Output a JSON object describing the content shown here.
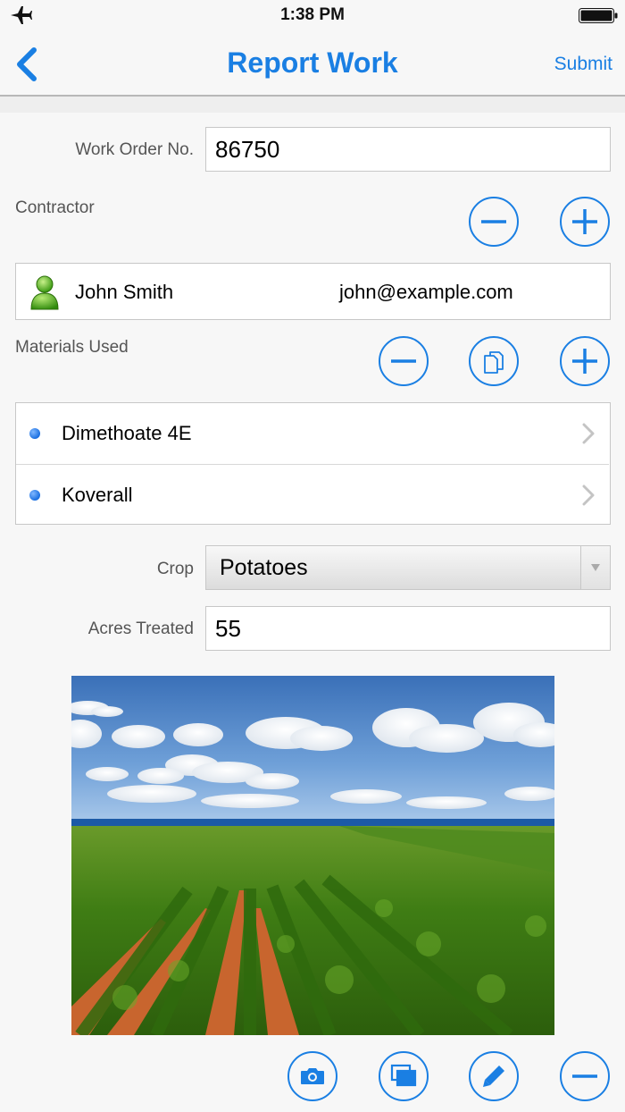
{
  "status_bar": {
    "time": "1:38 PM"
  },
  "nav": {
    "title": "Report Work",
    "submit_label": "Submit"
  },
  "form": {
    "work_order_label": "Work Order No.",
    "work_order_value": "86750",
    "contractor_label": "Contractor",
    "contractor": {
      "name": "John Smith",
      "email": "john@example.com"
    },
    "materials_label": "Materials Used",
    "materials": [
      {
        "label": "Dimethoate 4E"
      },
      {
        "label": "Koverall"
      }
    ],
    "crop_label": "Crop",
    "crop_value": "Potatoes",
    "acres_label": "Acres Treated",
    "acres_value": "55"
  },
  "icons": {
    "status": [
      "airplane-icon",
      "battery-icon"
    ],
    "nav": [
      "back-chevron-icon"
    ],
    "contractor_actions": [
      "minus-icon",
      "plus-icon"
    ],
    "materials_actions": [
      "minus-icon",
      "copy-icon",
      "plus-icon"
    ],
    "photo_actions": [
      "camera-icon",
      "gallery-icon",
      "pencil-icon",
      "minus-icon"
    ]
  },
  "colors": {
    "accent": "#1a7fe3",
    "background": "#f7f7f7"
  }
}
